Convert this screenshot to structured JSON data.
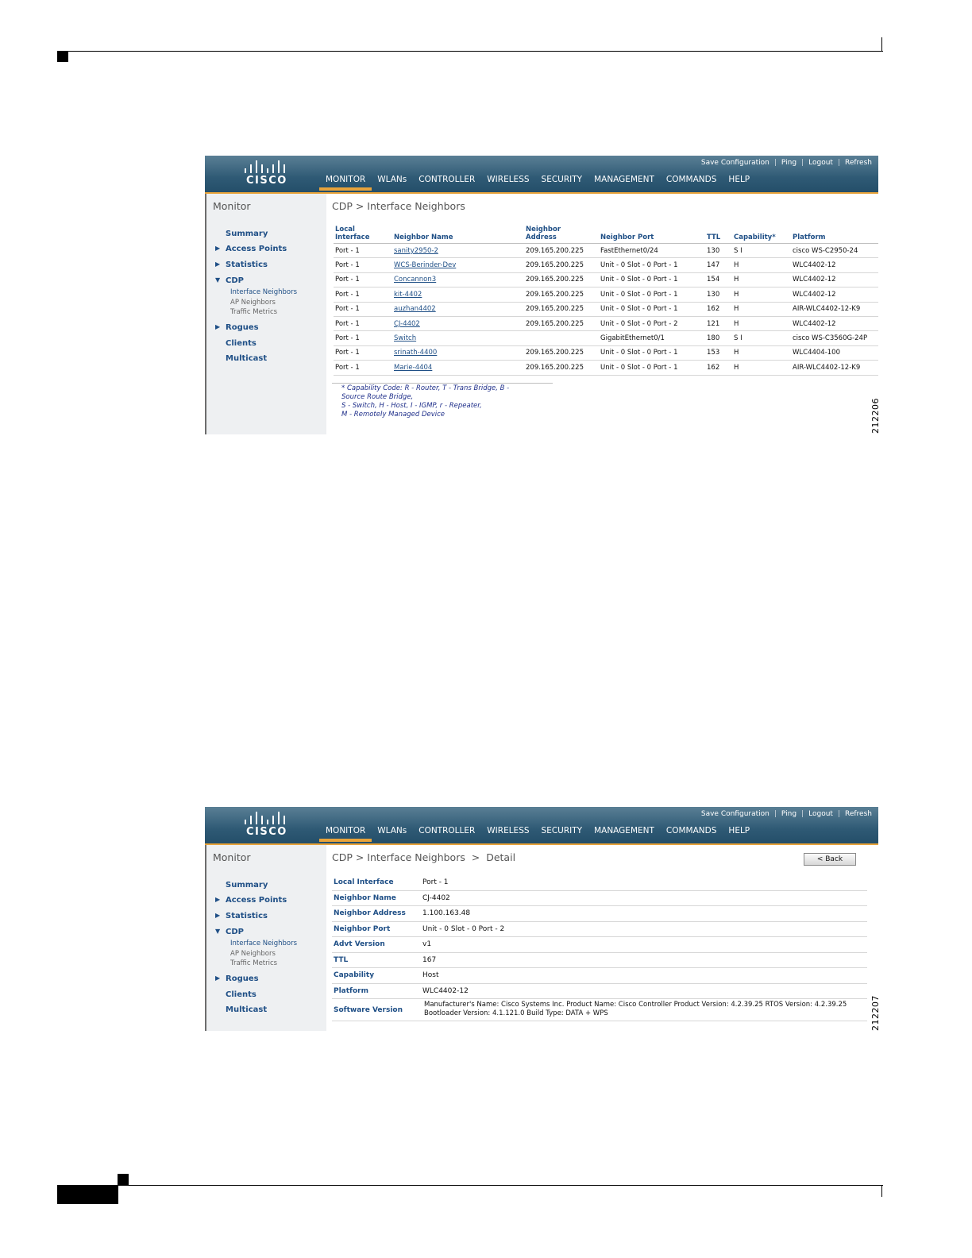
{
  "figures": {
    "fig1_number": "212206",
    "fig2_number": "212207"
  },
  "app": {
    "logo_text": "CISCO",
    "util_links": [
      "Save Configuration",
      "Ping",
      "Logout",
      "Refresh"
    ],
    "nav_tabs": [
      "MONITOR",
      "WLANs",
      "CONTROLLER",
      "WIRELESS",
      "SECURITY",
      "MANAGEMENT",
      "COMMANDS",
      "HELP"
    ],
    "active_tab": "MONITOR",
    "accent_color": "#e8a33a",
    "header_color": "#2f5a75"
  },
  "sidebar": {
    "title": "Monitor",
    "items": [
      {
        "label": "Summary"
      },
      {
        "label": "Access Points"
      },
      {
        "label": "Statistics"
      },
      {
        "label": "CDP"
      },
      {
        "label": "Rogues"
      },
      {
        "label": "Clients"
      },
      {
        "label": "Multicast"
      }
    ],
    "cdp_sub": [
      "Interface Neighbors",
      "AP Neighbors",
      "Traffic Metrics"
    ]
  },
  "screen1": {
    "breadcrumb": "CDP > Interface Neighbors",
    "columns": [
      "Local Interface",
      "Neighbor Name",
      "Neighbor Address",
      "Neighbor Port",
      "TTL",
      "Capability*",
      "Platform"
    ],
    "rows": [
      [
        "Port - 1",
        "sanity2950-2",
        "209.165.200.225",
        "FastEthernet0/24",
        "130",
        "S I",
        "cisco WS-C2950-24"
      ],
      [
        "Port - 1",
        "WCS-Berinder-Dev",
        "209.165.200.225",
        "Unit - 0 Slot - 0 Port - 1",
        "147",
        "H",
        "WLC4402-12"
      ],
      [
        "Port - 1",
        "Concannon3",
        "209.165.200.225",
        "Unit - 0 Slot - 0 Port - 1",
        "154",
        "H",
        "WLC4402-12"
      ],
      [
        "Port - 1",
        "kit-4402",
        "209.165.200.225",
        "Unit - 0 Slot - 0 Port - 1",
        "130",
        "H",
        "WLC4402-12"
      ],
      [
        "Port - 1",
        "auzhan4402",
        "209.165.200.225",
        "Unit - 0 Slot - 0 Port - 1",
        "162",
        "H",
        "AIR-WLC4402-12-K9"
      ],
      [
        "Port - 1",
        "CJ-4402",
        "209.165.200.225",
        "Unit - 0 Slot - 0 Port - 2",
        "121",
        "H",
        "WLC4402-12"
      ],
      [
        "Port - 1",
        "Switch",
        "",
        "GigabitEthernet0/1",
        "180",
        "S I",
        "cisco WS-C3560G-24P"
      ],
      [
        "Port - 1",
        "srinath-4400",
        "209.165.200.225",
        "Unit - 0 Slot - 0 Port - 1",
        "153",
        "H",
        "WLC4404-100"
      ],
      [
        "Port - 1",
        "Marie-4404",
        "209.165.200.225",
        "Unit - 0 Slot - 0 Port - 1",
        "162",
        "H",
        "AIR-WLC4402-12-K9"
      ]
    ],
    "note_lines": [
      "* Capability Code: R - Router, T - Trans Bridge, B -",
      "Source Route Bridge,",
      "S - Switch, H - Host, I - IGMP, r - Repeater,",
      "M - Remotely Managed Device"
    ]
  },
  "screen2": {
    "breadcrumb": "CDP > Interface Neighbors  >  Detail",
    "back_label": "< Back",
    "fields": [
      {
        "label": "Local Interface",
        "value": "Port - 1"
      },
      {
        "label": "Neighbor Name",
        "value": "CJ-4402"
      },
      {
        "label": "Neighbor Address",
        "value": "1.100.163.48"
      },
      {
        "label": "Neighbor Port",
        "value": "Unit - 0 Slot - 0 Port - 2"
      },
      {
        "label": "Advt Version",
        "value": "v1"
      },
      {
        "label": "TTL",
        "value": "167"
      },
      {
        "label": "Capability",
        "value": "Host"
      },
      {
        "label": "Platform",
        "value": "WLC4402-12"
      }
    ],
    "software_label": "Software Version",
    "software_value": "Manufacturer's Name: Cisco Systems Inc. Product Name: Cisco Controller Product Version: 4.2.39.25 RTOS Version: 4.2.39.25 Bootloader Version: 4.1.121.0 Build Type: DATA + WPS"
  }
}
